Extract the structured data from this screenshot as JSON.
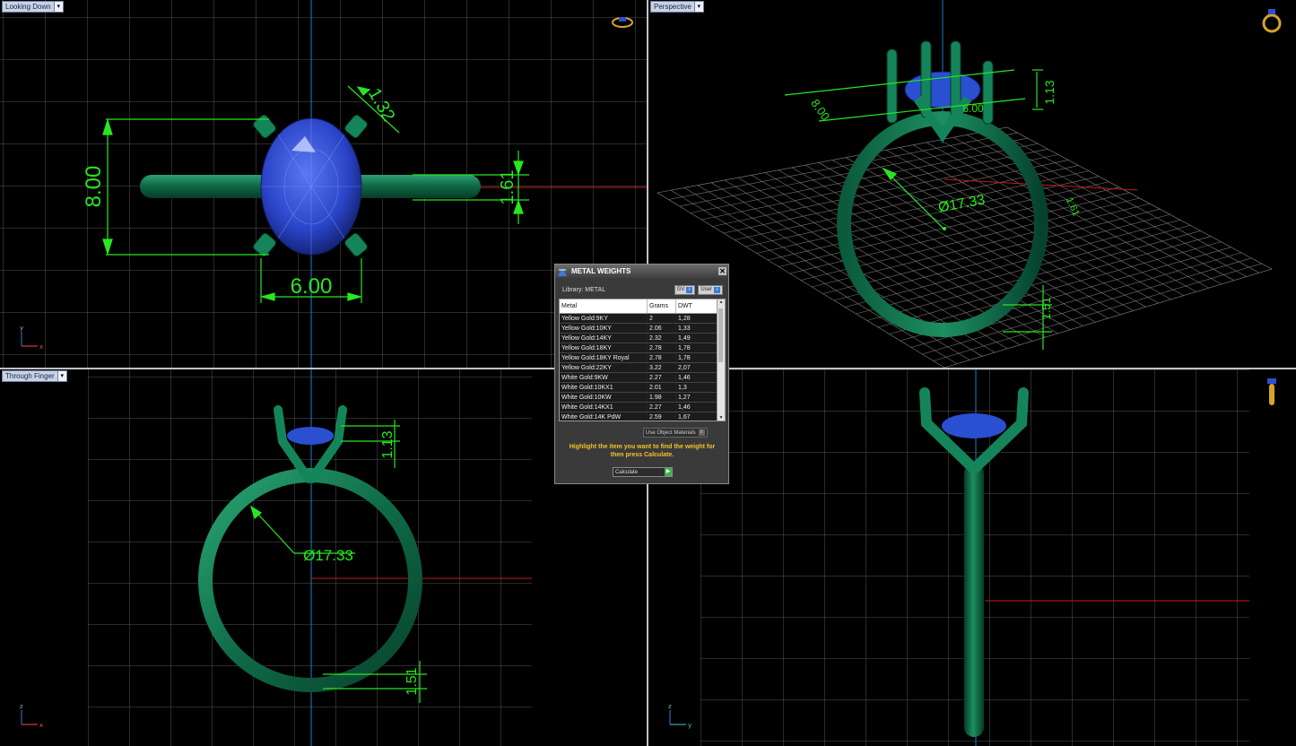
{
  "viewports": {
    "top_left": {
      "label": "Looking Down",
      "dims": {
        "height": "8.00",
        "width": "6.00",
        "prong": "1.32",
        "band": "1.61"
      },
      "axes": {
        "v": "y",
        "h": "x"
      }
    },
    "top_right": {
      "label": "Perspective",
      "dims": {
        "length": "8.00",
        "width": "6.00",
        "prong_h": "1.13",
        "diameter": "Ø17.33",
        "band_w": "1.61",
        "band_t": "1.51"
      }
    },
    "bottom_left": {
      "label": "Through Finger",
      "dims": {
        "prong_h": "1.13",
        "diameter": "Ø17.33",
        "band_t": "1.51"
      },
      "axes": {
        "v": "z",
        "h": "x"
      }
    },
    "bottom_right": {
      "label": "",
      "axes": {
        "v": "z",
        "h": "y"
      }
    }
  },
  "dialog": {
    "title": "METAL WEIGHTS",
    "library_label": "Library: METAL",
    "btn_gv": "GV",
    "btn_user": "User",
    "columns": [
      "Metal",
      "Grams",
      "DWT"
    ],
    "rows": [
      [
        "Yellow Gold:9KY",
        "2",
        "1,28"
      ],
      [
        "Yellow Gold:10KY",
        "2.06",
        "1,33"
      ],
      [
        "Yellow Gold:14KY",
        "2.32",
        "1,49"
      ],
      [
        "Yellow Gold:18KY",
        "2.78",
        "1,78"
      ],
      [
        "Yellow Gold:18KY Royal",
        "2.78",
        "1,78"
      ],
      [
        "Yellow Gold:22KY",
        "3.22",
        "2,07"
      ],
      [
        "White Gold:9KW",
        "2.27",
        "1,46"
      ],
      [
        "White Gold:10KX1",
        "2.01",
        "1,3"
      ],
      [
        "White Gold:10KW",
        "1.98",
        "1,27"
      ],
      [
        "White Gold:14KX1",
        "2.27",
        "1,46"
      ],
      [
        "White Gold:14K PdW",
        "2.59",
        "1,67"
      ]
    ],
    "use_materials": "Use Object Materials",
    "use_materials_value": "0",
    "hint": "Highlight the item you want to find the weight for then press Calculate.",
    "calc_label": "Calculate"
  },
  "colors": {
    "metal": "#0f6b48",
    "stone": "#2a4fd0",
    "dimension": "#27e81f",
    "grid": "#5a5a5a",
    "axis_red": "#c41a1a",
    "axis_blue": "#1c7ec8"
  }
}
